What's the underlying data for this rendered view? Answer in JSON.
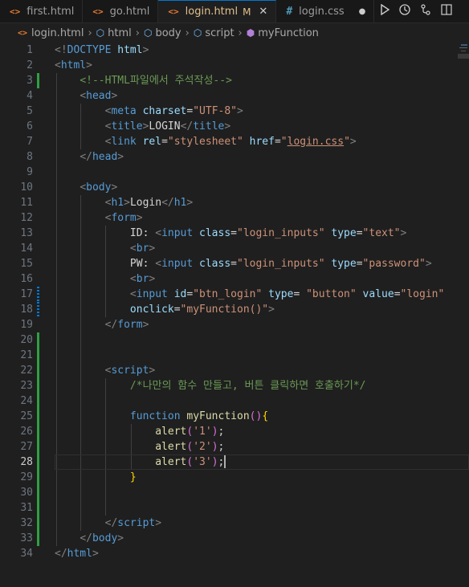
{
  "tabs": [
    {
      "label": "first.html",
      "icon": "html-file-icon",
      "active": false
    },
    {
      "label": "go.html",
      "icon": "html-file-icon",
      "active": false
    },
    {
      "label": "login.html",
      "icon": "html-file-icon",
      "active": true,
      "modified": "M"
    },
    {
      "label": "login.css",
      "icon": "css-file-icon",
      "active": false
    }
  ],
  "breadcrumb": [
    "login.html",
    "html",
    "body",
    "script",
    "myFunction"
  ],
  "editor": {
    "current_line": 28,
    "lines": [
      {
        "n": 1,
        "tokens": [
          [
            "br",
            "<!"
          ],
          [
            "tag",
            "DOCTYPE"
          ],
          [
            "txt",
            " "
          ],
          [
            "attr",
            "html"
          ],
          [
            "br",
            ">"
          ]
        ]
      },
      {
        "n": 2,
        "tokens": [
          [
            "br",
            "<"
          ],
          [
            "tag",
            "html"
          ],
          [
            "br",
            ">"
          ]
        ]
      },
      {
        "n": 3,
        "tokens": [
          [
            "txt",
            "    "
          ],
          [
            "cmt",
            "<!--HTML파일에서 주석작성-->"
          ]
        ]
      },
      {
        "n": 4,
        "tokens": [
          [
            "txt",
            "    "
          ],
          [
            "br",
            "<"
          ],
          [
            "tag",
            "head"
          ],
          [
            "br",
            ">"
          ]
        ]
      },
      {
        "n": 5,
        "tokens": [
          [
            "txt",
            "        "
          ],
          [
            "br",
            "<"
          ],
          [
            "tag",
            "meta"
          ],
          [
            "txt",
            " "
          ],
          [
            "attr",
            "charset"
          ],
          [
            "txt",
            "="
          ],
          [
            "str",
            "\"UTF-8\""
          ],
          [
            "br",
            ">"
          ]
        ]
      },
      {
        "n": 6,
        "tokens": [
          [
            "txt",
            "        "
          ],
          [
            "br",
            "<"
          ],
          [
            "tag",
            "title"
          ],
          [
            "br",
            ">"
          ],
          [
            "txt",
            "LOGIN"
          ],
          [
            "br",
            "</"
          ],
          [
            "tag",
            "title"
          ],
          [
            "br",
            ">"
          ]
        ]
      },
      {
        "n": 7,
        "tokens": [
          [
            "txt",
            "        "
          ],
          [
            "br",
            "<"
          ],
          [
            "tag",
            "link"
          ],
          [
            "txt",
            " "
          ],
          [
            "attr",
            "rel"
          ],
          [
            "txt",
            "="
          ],
          [
            "str",
            "\"stylesheet\""
          ],
          [
            "txt",
            " "
          ],
          [
            "attr",
            "href"
          ],
          [
            "txt",
            "="
          ],
          [
            "str",
            "\""
          ],
          [
            "link",
            "login.css"
          ],
          [
            "str",
            "\""
          ],
          [
            "br",
            ">"
          ]
        ]
      },
      {
        "n": 8,
        "tokens": [
          [
            "txt",
            "    "
          ],
          [
            "br",
            "</"
          ],
          [
            "tag",
            "head"
          ],
          [
            "br",
            ">"
          ]
        ]
      },
      {
        "n": 9,
        "tokens": []
      },
      {
        "n": 10,
        "tokens": [
          [
            "txt",
            "    "
          ],
          [
            "br",
            "<"
          ],
          [
            "tag",
            "body"
          ],
          [
            "br",
            ">"
          ]
        ]
      },
      {
        "n": 11,
        "tokens": [
          [
            "txt",
            "        "
          ],
          [
            "br",
            "<"
          ],
          [
            "tag",
            "h1"
          ],
          [
            "br",
            ">"
          ],
          [
            "txt",
            "Login"
          ],
          [
            "br",
            "</"
          ],
          [
            "tag",
            "h1"
          ],
          [
            "br",
            ">"
          ]
        ]
      },
      {
        "n": 12,
        "tokens": [
          [
            "txt",
            "        "
          ],
          [
            "br",
            "<"
          ],
          [
            "tag",
            "form"
          ],
          [
            "br",
            ">"
          ]
        ]
      },
      {
        "n": 13,
        "tokens": [
          [
            "txt",
            "            ID: "
          ],
          [
            "br",
            "<"
          ],
          [
            "tag",
            "input"
          ],
          [
            "txt",
            " "
          ],
          [
            "attr",
            "class"
          ],
          [
            "txt",
            "="
          ],
          [
            "str",
            "\"login_inputs\""
          ],
          [
            "txt",
            " "
          ],
          [
            "attr",
            "type"
          ],
          [
            "txt",
            "="
          ],
          [
            "str",
            "\"text\""
          ],
          [
            "br",
            ">"
          ]
        ]
      },
      {
        "n": 14,
        "tokens": [
          [
            "txt",
            "            "
          ],
          [
            "br",
            "<"
          ],
          [
            "tag",
            "br"
          ],
          [
            "br",
            ">"
          ]
        ]
      },
      {
        "n": 15,
        "tokens": [
          [
            "txt",
            "            PW: "
          ],
          [
            "br",
            "<"
          ],
          [
            "tag",
            "input"
          ],
          [
            "txt",
            " "
          ],
          [
            "attr",
            "class"
          ],
          [
            "txt",
            "="
          ],
          [
            "str",
            "\"login_inputs\""
          ],
          [
            "txt",
            " "
          ],
          [
            "attr",
            "type"
          ],
          [
            "txt",
            "="
          ],
          [
            "str",
            "\"password\""
          ],
          [
            "br",
            ">"
          ]
        ]
      },
      {
        "n": 16,
        "tokens": [
          [
            "txt",
            "            "
          ],
          [
            "br",
            "<"
          ],
          [
            "tag",
            "br"
          ],
          [
            "br",
            ">"
          ]
        ]
      },
      {
        "n": 17,
        "tokens": [
          [
            "txt",
            "            "
          ],
          [
            "br",
            "<"
          ],
          [
            "tag",
            "input"
          ],
          [
            "txt",
            " "
          ],
          [
            "attr",
            "id"
          ],
          [
            "txt",
            "="
          ],
          [
            "str",
            "\"btn_login\""
          ],
          [
            "txt",
            " "
          ],
          [
            "attr",
            "type"
          ],
          [
            "txt",
            "= "
          ],
          [
            "str",
            "\"button\""
          ],
          [
            "txt",
            " "
          ],
          [
            "attr",
            "value"
          ],
          [
            "txt",
            "="
          ],
          [
            "str",
            "\"login\""
          ]
        ]
      },
      {
        "n": 18,
        "tokens": [
          [
            "txt",
            "            "
          ],
          [
            "attr",
            "onclick"
          ],
          [
            "txt",
            "="
          ],
          [
            "str",
            "\"myFunction()\""
          ],
          [
            "br",
            ">"
          ]
        ]
      },
      {
        "n": 19,
        "tokens": [
          [
            "txt",
            "        "
          ],
          [
            "br",
            "</"
          ],
          [
            "tag",
            "form"
          ],
          [
            "br",
            ">"
          ]
        ]
      },
      {
        "n": 20,
        "tokens": []
      },
      {
        "n": 21,
        "tokens": []
      },
      {
        "n": 22,
        "tokens": [
          [
            "txt",
            "        "
          ],
          [
            "br",
            "<"
          ],
          [
            "tag",
            "script"
          ],
          [
            "br",
            ">"
          ]
        ]
      },
      {
        "n": 23,
        "tokens": [
          [
            "txt",
            "            "
          ],
          [
            "cmt",
            "/*나만의 함수 만들고, 버튼 클릭하면 호출하기*/"
          ]
        ]
      },
      {
        "n": 24,
        "tokens": []
      },
      {
        "n": 25,
        "tokens": [
          [
            "txt",
            "            "
          ],
          [
            "kw",
            "function"
          ],
          [
            "txt",
            " "
          ],
          [
            "fn",
            "myFunction"
          ],
          [
            "brace",
            "()"
          ],
          [
            "brace2",
            "{"
          ]
        ]
      },
      {
        "n": 26,
        "tokens": [
          [
            "txt",
            "                "
          ],
          [
            "fn",
            "alert"
          ],
          [
            "brace",
            "("
          ],
          [
            "str",
            "'1'"
          ],
          [
            "brace",
            ")"
          ],
          [
            "txt",
            ";"
          ]
        ]
      },
      {
        "n": 27,
        "tokens": [
          [
            "txt",
            "                "
          ],
          [
            "fn",
            "alert"
          ],
          [
            "brace",
            "("
          ],
          [
            "str",
            "'2'"
          ],
          [
            "brace",
            ")"
          ],
          [
            "txt",
            ";"
          ]
        ]
      },
      {
        "n": 28,
        "tokens": [
          [
            "txt",
            "                "
          ],
          [
            "fn",
            "alert"
          ],
          [
            "brace",
            "("
          ],
          [
            "str",
            "'3'"
          ],
          [
            "brace",
            ")"
          ],
          [
            "txt",
            ";"
          ]
        ]
      },
      {
        "n": 29,
        "tokens": [
          [
            "txt",
            "            "
          ],
          [
            "brace2",
            "}"
          ]
        ]
      },
      {
        "n": 30,
        "tokens": []
      },
      {
        "n": 31,
        "tokens": []
      },
      {
        "n": 32,
        "tokens": [
          [
            "txt",
            "        "
          ],
          [
            "br",
            "</"
          ],
          [
            "tag",
            "script"
          ],
          [
            "br",
            ">"
          ]
        ]
      },
      {
        "n": 33,
        "tokens": [
          [
            "txt",
            "    "
          ],
          [
            "br",
            "</"
          ],
          [
            "tag",
            "body"
          ],
          [
            "br",
            ">"
          ]
        ]
      },
      {
        "n": 34,
        "tokens": [
          [
            "br",
            "</"
          ],
          [
            "tag",
            "html"
          ],
          [
            "br",
            ">"
          ]
        ]
      }
    ]
  },
  "colors": {
    "tag": "#569cd6",
    "attr": "#9cdcfe",
    "string": "#ce9178",
    "comment": "#6a9955",
    "function": "#dcdcaa",
    "brace": "#da70d6",
    "brace2": "#ffd700",
    "added": "#2ea043",
    "modified": "#0078d4"
  }
}
